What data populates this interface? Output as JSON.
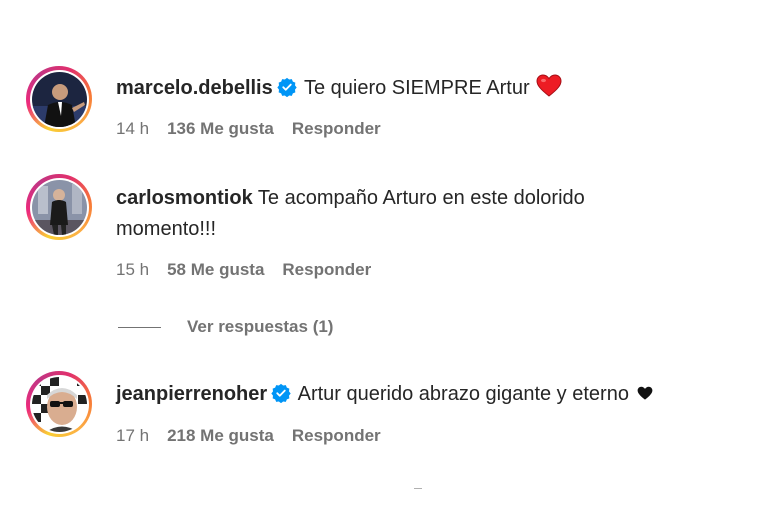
{
  "comments": [
    {
      "username": "marcelo.debellis",
      "verified": true,
      "text": "Te quiero SIEMPRE Artur",
      "emoji": "red-heart",
      "time": "14 h",
      "likes": "136 Me gusta",
      "reply": "Responder"
    },
    {
      "username": "carlosmontiok",
      "verified": false,
      "text": "Te acompaño Arturo en este dolorido",
      "text_line2": "momento!!!",
      "time": "15 h",
      "likes": "58 Me gusta",
      "reply": "Responder"
    },
    {
      "username": "jeanpierrenoher",
      "verified": true,
      "text": "Artur querido abrazo gigante y eterno",
      "emoji": "black-heart",
      "time": "17 h",
      "likes": "218 Me gusta",
      "reply": "Responder"
    }
  ],
  "view_replies": "Ver respuestas (1)",
  "colors": {
    "text": "#262626",
    "secondary": "#737373",
    "verified_blue": "#0095f6",
    "heart_red": "#ed1c24"
  }
}
